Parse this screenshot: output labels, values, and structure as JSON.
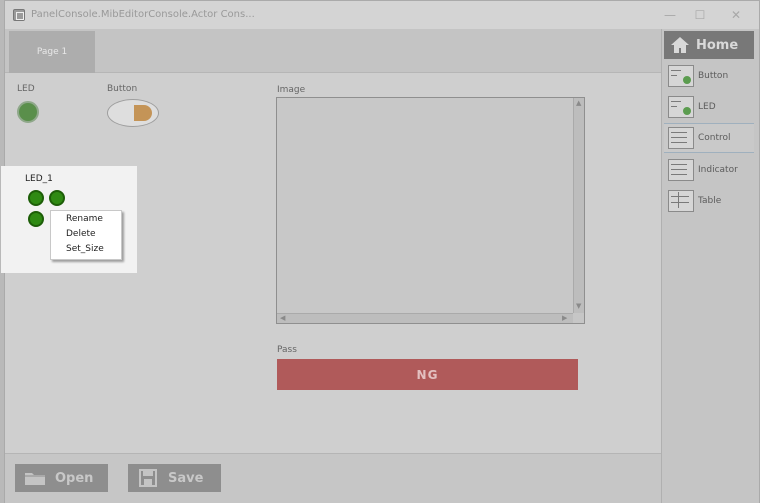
{
  "window": {
    "title": "PanelConsole.MibEditorConsole.Actor Cons..."
  },
  "tabs": [
    {
      "label": "Page 1"
    }
  ],
  "canvas": {
    "led_label": "LED",
    "button_label": "Button",
    "image_label": "Image",
    "pass_label": "Pass",
    "ng_text": "NG",
    "led1_label": "LED_1"
  },
  "context_menu": {
    "items": [
      "Rename",
      "Delete",
      "Set_Size"
    ]
  },
  "bottom": {
    "open_label": "Open",
    "save_label": "Save"
  },
  "right_panel": {
    "home_label": "Home",
    "items": [
      {
        "label": "Button",
        "icon": "button-widget-icon"
      },
      {
        "label": "LED",
        "icon": "led-widget-icon"
      },
      {
        "label": "Control",
        "icon": "control-widget-icon"
      },
      {
        "label": "Indicator",
        "icon": "indicator-widget-icon"
      },
      {
        "label": "Table",
        "icon": "table-widget-icon"
      }
    ]
  },
  "colors": {
    "ng_bar": "#b05a5a",
    "led_green": "#2f8a13",
    "home_bg": "#787878"
  }
}
